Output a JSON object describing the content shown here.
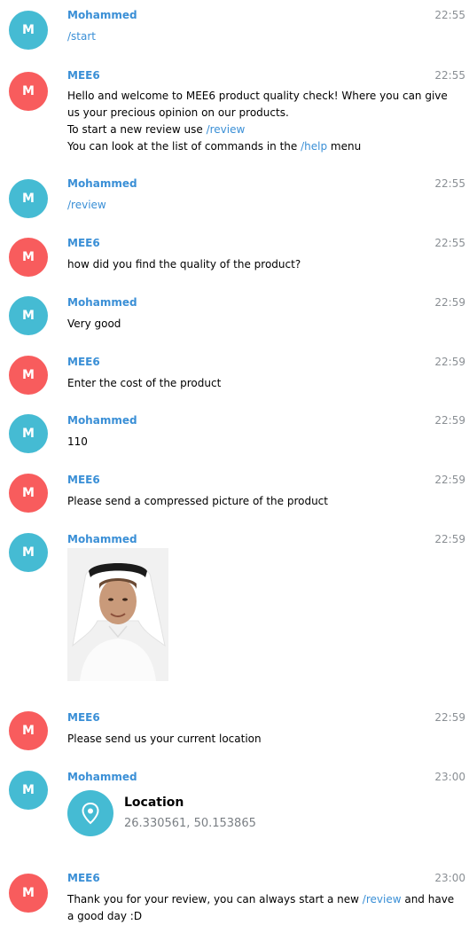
{
  "messages": [
    {
      "sender": "Mohammed",
      "avatar": "M",
      "time": "22:55",
      "cmd": "/start"
    },
    {
      "sender": "MEE6",
      "avatar": "M",
      "time": "22:55",
      "lines": [
        "Hello and welcome to MEE6 product quality check! Where you can give",
        "us your precious opinion on our products.",
        "To start a new review use",
        "/review",
        "You can look at the list of commands in the",
        "/help",
        "menu"
      ]
    },
    {
      "sender": "Mohammed",
      "avatar": "M",
      "time": "22:55",
      "cmd": "/review"
    },
    {
      "sender": "MEE6",
      "avatar": "M",
      "time": "22:55",
      "text": "how did you find the quality of the product?"
    },
    {
      "sender": "Mohammed",
      "avatar": "M",
      "time": "22:59",
      "text": "Very good"
    },
    {
      "sender": "MEE6",
      "avatar": "M",
      "time": "22:59",
      "text": "Enter the cost of the product"
    },
    {
      "sender": "Mohammed",
      "avatar": "M",
      "time": "22:59",
      "text": "110"
    },
    {
      "sender": "MEE6",
      "avatar": "M",
      "time": "22:59",
      "text": "Please send a compressed picture of the product"
    },
    {
      "sender": "Mohammed",
      "avatar": "M",
      "time": "22:59"
    },
    {
      "sender": "MEE6",
      "avatar": "M",
      "time": "22:59",
      "text": "Please send us your current location"
    },
    {
      "sender": "Mohammed",
      "avatar": "M",
      "time": "23:00",
      "location": {
        "title": "Location",
        "coords": "26.330561, 50.153865",
        "icon": "map-pin-icon"
      }
    },
    {
      "sender": "MEE6",
      "avatar": "M",
      "time": "23:00",
      "lines": [
        "Thank you for your review, you can always start a new",
        "/review",
        "and have",
        "a good day :D"
      ]
    }
  ],
  "colors": {
    "user_avatar": "#45bbd3",
    "bot_avatar": "#f85c5d",
    "link": "#3a8fd6",
    "time": "#8a8f94"
  }
}
